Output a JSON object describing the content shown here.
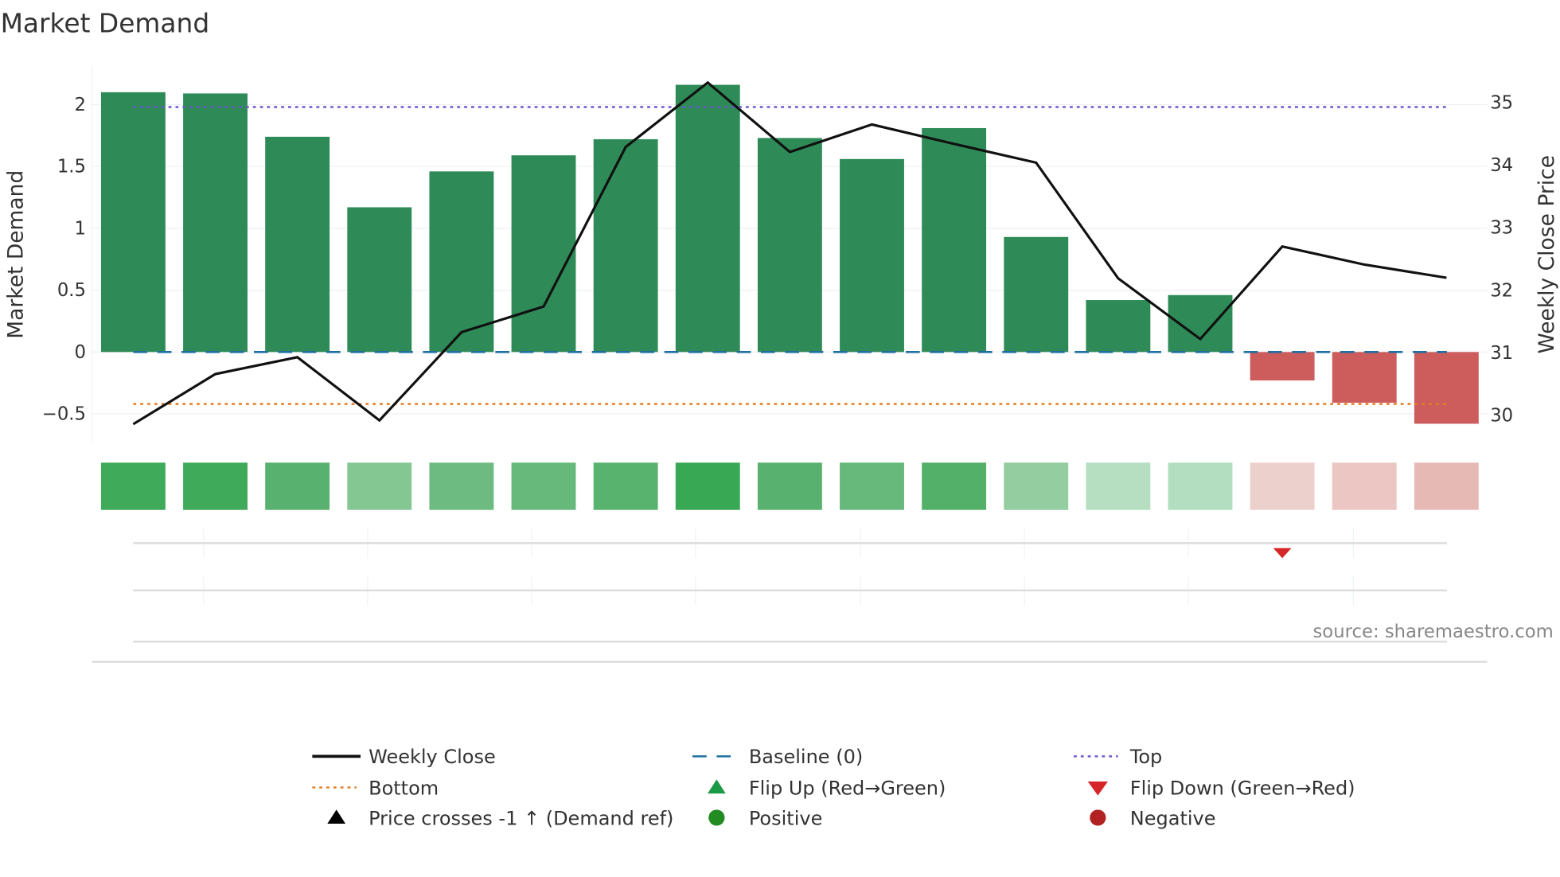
{
  "chart_data": {
    "type": "bar",
    "title": "Market Demand",
    "ylabel": "Market Demand",
    "y2label": "Weekly Close Price",
    "ylim": [
      -0.72,
      2.3
    ],
    "y2lim": [
      29.8,
      35.55
    ],
    "yticks": [
      {
        "v": -0.5,
        "label": "−0.5"
      },
      {
        "v": 0,
        "label": "0"
      },
      {
        "v": 0.5,
        "label": "0.5"
      },
      {
        "v": 1,
        "label": "1"
      },
      {
        "v": 1.5,
        "label": "1.5"
      },
      {
        "v": 2,
        "label": "2"
      }
    ],
    "y2ticks": [
      {
        "v": 30,
        "label": "30"
      },
      {
        "v": 31,
        "label": "31"
      },
      {
        "v": 32,
        "label": "32"
      },
      {
        "v": 33,
        "label": "33"
      },
      {
        "v": 34,
        "label": "34"
      },
      {
        "v": 35,
        "label": "35"
      }
    ],
    "demand": [
      2.1,
      2.09,
      1.74,
      1.17,
      1.46,
      1.59,
      1.72,
      2.16,
      1.73,
      1.56,
      1.81,
      0.93,
      0.42,
      0.46,
      -0.23,
      -0.41,
      -0.58
    ],
    "weekly_close": [
      29.86,
      30.66,
      30.93,
      29.92,
      31.33,
      31.74,
      34.29,
      35.32,
      34.21,
      34.65,
      34.34,
      34.04,
      32.19,
      31.22,
      32.7,
      32.41,
      32.2
    ],
    "top": 1.98,
    "bottom": -0.42,
    "baseline": 0,
    "flip_down_index": [
      14
    ],
    "heat_colors": [
      "#3faa5a",
      "#3faa5a",
      "#59b16f",
      "#84c792",
      "#6dbb80",
      "#66b97b",
      "#58b36e",
      "#39a855",
      "#58b16e",
      "#66b97b",
      "#53b069",
      "#93cda0",
      "#b6dfc2",
      "#b3dec0",
      "#ecd0cc",
      "#ebc6c3",
      "#e7b9b5"
    ],
    "colors": {
      "positive": "#2e8b57",
      "negative": "#cd5c5c",
      "line": "#111111",
      "top": "#6a5acd",
      "bottom": "#e67e22",
      "baseline": "#1f6fa0",
      "flip_down": "#d62728"
    },
    "legend": [
      {
        "label": "Weekly Close",
        "kind": "line"
      },
      {
        "label": "Baseline (0)",
        "kind": "dash"
      },
      {
        "label": "Top",
        "kind": "dotblue"
      },
      {
        "label": "Bottom",
        "kind": "dotorange"
      },
      {
        "label": "Flip Up (Red→Green)",
        "kind": "triup"
      },
      {
        "label": "Flip Down (Green→Red)",
        "kind": "tridown"
      },
      {
        "label": "Price crosses -1 ↑ (Demand ref)",
        "kind": "triblack"
      },
      {
        "label": "Positive",
        "kind": "dotgreen"
      },
      {
        "label": "Negative",
        "kind": "dotred"
      }
    ],
    "source": "source: sharemaestro.com"
  }
}
